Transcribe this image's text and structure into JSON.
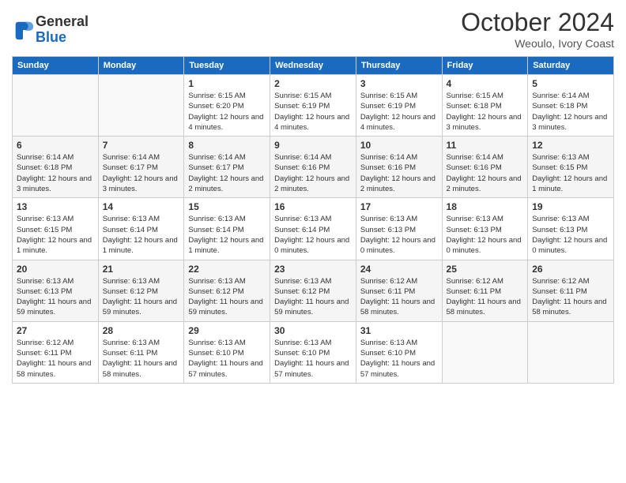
{
  "logo": {
    "line1": "General",
    "line2": "Blue"
  },
  "header": {
    "month": "October 2024",
    "location": "Weoulo, Ivory Coast"
  },
  "weekdays": [
    "Sunday",
    "Monday",
    "Tuesday",
    "Wednesday",
    "Thursday",
    "Friday",
    "Saturday"
  ],
  "weeks": [
    [
      {
        "day": "",
        "sunrise": "",
        "sunset": "",
        "daylight": ""
      },
      {
        "day": "",
        "sunrise": "",
        "sunset": "",
        "daylight": ""
      },
      {
        "day": "1",
        "sunrise": "Sunrise: 6:15 AM",
        "sunset": "Sunset: 6:20 PM",
        "daylight": "Daylight: 12 hours and 4 minutes."
      },
      {
        "day": "2",
        "sunrise": "Sunrise: 6:15 AM",
        "sunset": "Sunset: 6:19 PM",
        "daylight": "Daylight: 12 hours and 4 minutes."
      },
      {
        "day": "3",
        "sunrise": "Sunrise: 6:15 AM",
        "sunset": "Sunset: 6:19 PM",
        "daylight": "Daylight: 12 hours and 4 minutes."
      },
      {
        "day": "4",
        "sunrise": "Sunrise: 6:15 AM",
        "sunset": "Sunset: 6:18 PM",
        "daylight": "Daylight: 12 hours and 3 minutes."
      },
      {
        "day": "5",
        "sunrise": "Sunrise: 6:14 AM",
        "sunset": "Sunset: 6:18 PM",
        "daylight": "Daylight: 12 hours and 3 minutes."
      }
    ],
    [
      {
        "day": "6",
        "sunrise": "Sunrise: 6:14 AM",
        "sunset": "Sunset: 6:18 PM",
        "daylight": "Daylight: 12 hours and 3 minutes."
      },
      {
        "day": "7",
        "sunrise": "Sunrise: 6:14 AM",
        "sunset": "Sunset: 6:17 PM",
        "daylight": "Daylight: 12 hours and 3 minutes."
      },
      {
        "day": "8",
        "sunrise": "Sunrise: 6:14 AM",
        "sunset": "Sunset: 6:17 PM",
        "daylight": "Daylight: 12 hours and 2 minutes."
      },
      {
        "day": "9",
        "sunrise": "Sunrise: 6:14 AM",
        "sunset": "Sunset: 6:16 PM",
        "daylight": "Daylight: 12 hours and 2 minutes."
      },
      {
        "day": "10",
        "sunrise": "Sunrise: 6:14 AM",
        "sunset": "Sunset: 6:16 PM",
        "daylight": "Daylight: 12 hours and 2 minutes."
      },
      {
        "day": "11",
        "sunrise": "Sunrise: 6:14 AM",
        "sunset": "Sunset: 6:16 PM",
        "daylight": "Daylight: 12 hours and 2 minutes."
      },
      {
        "day": "12",
        "sunrise": "Sunrise: 6:13 AM",
        "sunset": "Sunset: 6:15 PM",
        "daylight": "Daylight: 12 hours and 1 minute."
      }
    ],
    [
      {
        "day": "13",
        "sunrise": "Sunrise: 6:13 AM",
        "sunset": "Sunset: 6:15 PM",
        "daylight": "Daylight: 12 hours and 1 minute."
      },
      {
        "day": "14",
        "sunrise": "Sunrise: 6:13 AM",
        "sunset": "Sunset: 6:14 PM",
        "daylight": "Daylight: 12 hours and 1 minute."
      },
      {
        "day": "15",
        "sunrise": "Sunrise: 6:13 AM",
        "sunset": "Sunset: 6:14 PM",
        "daylight": "Daylight: 12 hours and 1 minute."
      },
      {
        "day": "16",
        "sunrise": "Sunrise: 6:13 AM",
        "sunset": "Sunset: 6:14 PM",
        "daylight": "Daylight: 12 hours and 0 minutes."
      },
      {
        "day": "17",
        "sunrise": "Sunrise: 6:13 AM",
        "sunset": "Sunset: 6:13 PM",
        "daylight": "Daylight: 12 hours and 0 minutes."
      },
      {
        "day": "18",
        "sunrise": "Sunrise: 6:13 AM",
        "sunset": "Sunset: 6:13 PM",
        "daylight": "Daylight: 12 hours and 0 minutes."
      },
      {
        "day": "19",
        "sunrise": "Sunrise: 6:13 AM",
        "sunset": "Sunset: 6:13 PM",
        "daylight": "Daylight: 12 hours and 0 minutes."
      }
    ],
    [
      {
        "day": "20",
        "sunrise": "Sunrise: 6:13 AM",
        "sunset": "Sunset: 6:13 PM",
        "daylight": "Daylight: 11 hours and 59 minutes."
      },
      {
        "day": "21",
        "sunrise": "Sunrise: 6:13 AM",
        "sunset": "Sunset: 6:12 PM",
        "daylight": "Daylight: 11 hours and 59 minutes."
      },
      {
        "day": "22",
        "sunrise": "Sunrise: 6:13 AM",
        "sunset": "Sunset: 6:12 PM",
        "daylight": "Daylight: 11 hours and 59 minutes."
      },
      {
        "day": "23",
        "sunrise": "Sunrise: 6:13 AM",
        "sunset": "Sunset: 6:12 PM",
        "daylight": "Daylight: 11 hours and 59 minutes."
      },
      {
        "day": "24",
        "sunrise": "Sunrise: 6:12 AM",
        "sunset": "Sunset: 6:11 PM",
        "daylight": "Daylight: 11 hours and 58 minutes."
      },
      {
        "day": "25",
        "sunrise": "Sunrise: 6:12 AM",
        "sunset": "Sunset: 6:11 PM",
        "daylight": "Daylight: 11 hours and 58 minutes."
      },
      {
        "day": "26",
        "sunrise": "Sunrise: 6:12 AM",
        "sunset": "Sunset: 6:11 PM",
        "daylight": "Daylight: 11 hours and 58 minutes."
      }
    ],
    [
      {
        "day": "27",
        "sunrise": "Sunrise: 6:12 AM",
        "sunset": "Sunset: 6:11 PM",
        "daylight": "Daylight: 11 hours and 58 minutes."
      },
      {
        "day": "28",
        "sunrise": "Sunrise: 6:13 AM",
        "sunset": "Sunset: 6:11 PM",
        "daylight": "Daylight: 11 hours and 58 minutes."
      },
      {
        "day": "29",
        "sunrise": "Sunrise: 6:13 AM",
        "sunset": "Sunset: 6:10 PM",
        "daylight": "Daylight: 11 hours and 57 minutes."
      },
      {
        "day": "30",
        "sunrise": "Sunrise: 6:13 AM",
        "sunset": "Sunset: 6:10 PM",
        "daylight": "Daylight: 11 hours and 57 minutes."
      },
      {
        "day": "31",
        "sunrise": "Sunrise: 6:13 AM",
        "sunset": "Sunset: 6:10 PM",
        "daylight": "Daylight: 11 hours and 57 minutes."
      },
      {
        "day": "",
        "sunrise": "",
        "sunset": "",
        "daylight": ""
      },
      {
        "day": "",
        "sunrise": "",
        "sunset": "",
        "daylight": ""
      }
    ]
  ]
}
